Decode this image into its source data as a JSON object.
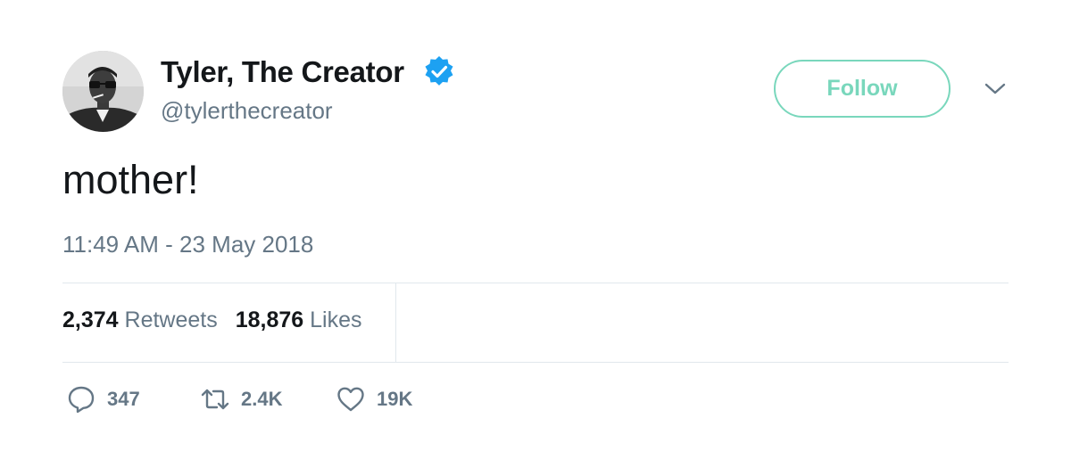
{
  "author": {
    "display_name": "Tyler, The Creator",
    "handle": "@tylerthecreator",
    "verified": true
  },
  "header": {
    "follow_label": "Follow"
  },
  "tweet": {
    "text": "mother!",
    "timestamp": "11:49 AM - 23 May 2018"
  },
  "stats": {
    "retweets_count": "2,374",
    "retweets_label": "Retweets",
    "likes_count": "18,876",
    "likes_label": "Likes"
  },
  "actions": {
    "reply_count": "347",
    "retweet_count": "2.4K",
    "like_count": "19K"
  },
  "colors": {
    "follow_accent": "#79d7bc",
    "verified_blue": "#1da1f2",
    "secondary_text": "#657786",
    "divider": "#e1e8ed"
  },
  "icons": [
    "verified-badge-icon",
    "chevron-down-icon",
    "reply-icon",
    "retweet-icon",
    "like-icon"
  ]
}
